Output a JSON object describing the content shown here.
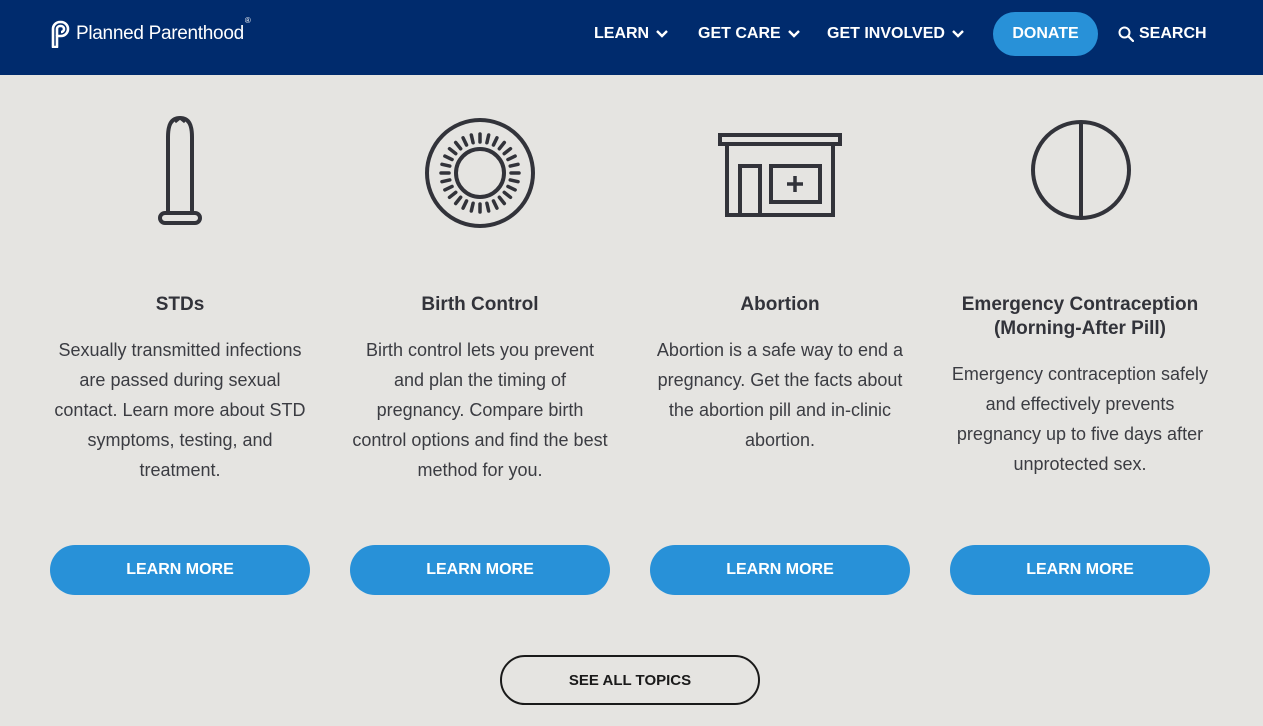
{
  "header": {
    "logo_text": "Planned Parenthood",
    "logo_mark": "®",
    "nav": [
      {
        "label": "LEARN"
      },
      {
        "label": "GET CARE"
      },
      {
        "label": "GET INVOLVED"
      }
    ],
    "donate_label": "DONATE",
    "search_label": "SEARCH"
  },
  "cards": [
    {
      "icon": "condom-icon",
      "title": "STDs",
      "text": "Sexually transmitted infections are passed during sexual contact. Learn more about STD symptoms, testing, and treatment.",
      "button": "LEARN MORE"
    },
    {
      "icon": "pill-pack-icon",
      "title": "Birth Control",
      "text": "Birth control lets you prevent and plan the timing of pregnancy. Compare birth control options and find the best method for you.",
      "button": "LEARN MORE"
    },
    {
      "icon": "clinic-building-icon",
      "title": "Abortion",
      "text": "Abortion is a safe way to end a pregnancy. Get the facts about the abortion pill and in-clinic abortion.",
      "button": "LEARN MORE"
    },
    {
      "icon": "split-pill-icon",
      "title": "Emergency Contraception (Morning-After Pill)",
      "text": "Emergency contraception safely and effectively prevents pregnancy up to five days after unprotected sex.",
      "button": "LEARN MORE"
    }
  ],
  "see_all_label": "SEE ALL TOPICS",
  "colors": {
    "header_bg": "#002b6d",
    "accent": "#2891d8",
    "page_bg": "#e5e4e1",
    "icon_stroke": "#32333a"
  }
}
